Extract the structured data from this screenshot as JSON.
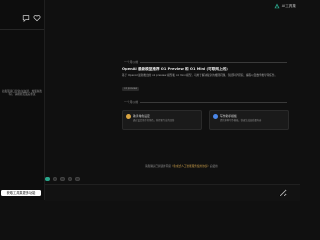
{
  "brand": {
    "name": "AI工具集",
    "logo_color": "#2aa58a",
    "logo": "brand-logo-icon"
  },
  "sidebar": {
    "icons": [
      "chat-icon",
      "heart-icon"
    ],
    "note": "如发现接口异常(如白屏、加载失败等)，请刷新页面后重试",
    "bottom_button": "获取工具集更多功能"
  },
  "chat": {
    "separator_1": "一个月以前",
    "message": {
      "title": "OpenAI 最新模型推荐 O1 Preview 和 O1 Mini (可联网上线)",
      "body": "基于 OpenAI 最新推出的 o1 preview 模型和 o1 mini 模型，可用于解决复杂的推理问题，包括科学研究、编程以及数学推导等任务。",
      "chip": "o1 preview"
    },
    "separator_2": "一个月以前",
    "cards": [
      {
        "title": "助手角色设定",
        "desc": "通过设定助手的角色，获得更专业的回答"
      },
      {
        "title": "写作助手模板",
        "desc": "提供多种写作模板，快速生成高质量内容"
      }
    ],
    "footnote_prefix": "请您确认已阅读并同意",
    "footnote_link": "《生成式人工智能服务使用协议》",
    "footnote_suffix": "后使用"
  },
  "toolbar": {
    "items": [
      "model-select-icon",
      "image-icon",
      "attach-icon",
      "settings-icon",
      "more-icon"
    ]
  },
  "input": {
    "placeholder": ""
  },
  "colors": {
    "background": "#101010",
    "sidebar": "#0d0d0d",
    "accent": "#2aa58a",
    "link": "#d0a24a"
  }
}
